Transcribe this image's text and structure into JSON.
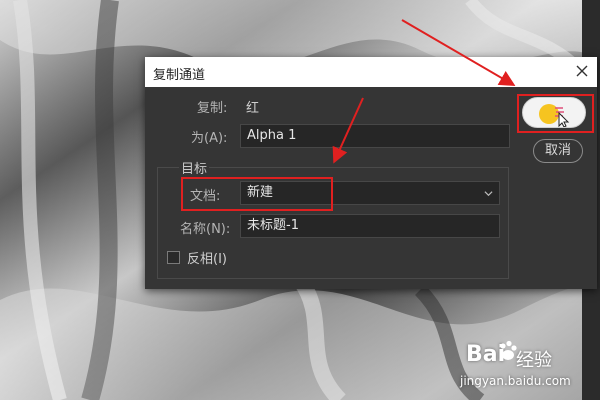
{
  "dialog": {
    "title": "复制通道",
    "source_label": "复制:",
    "source_value": "红",
    "as_label": "为(A):",
    "as_value": "Alpha 1",
    "group_title": "目标",
    "document_label": "文档:",
    "document_value": "新建",
    "name_label": "名称(N):",
    "name_value": "未标题-1",
    "invert_label": "反相(I)",
    "invert_checked": false,
    "cancel_label": "取消"
  },
  "watermark": {
    "logo": "Bai",
    "brand": "经验",
    "url": "jingyan.baidu.com"
  },
  "colors": {
    "dialog_bg": "#353535",
    "field_bg": "#262626",
    "annotation_red": "#e02020"
  }
}
